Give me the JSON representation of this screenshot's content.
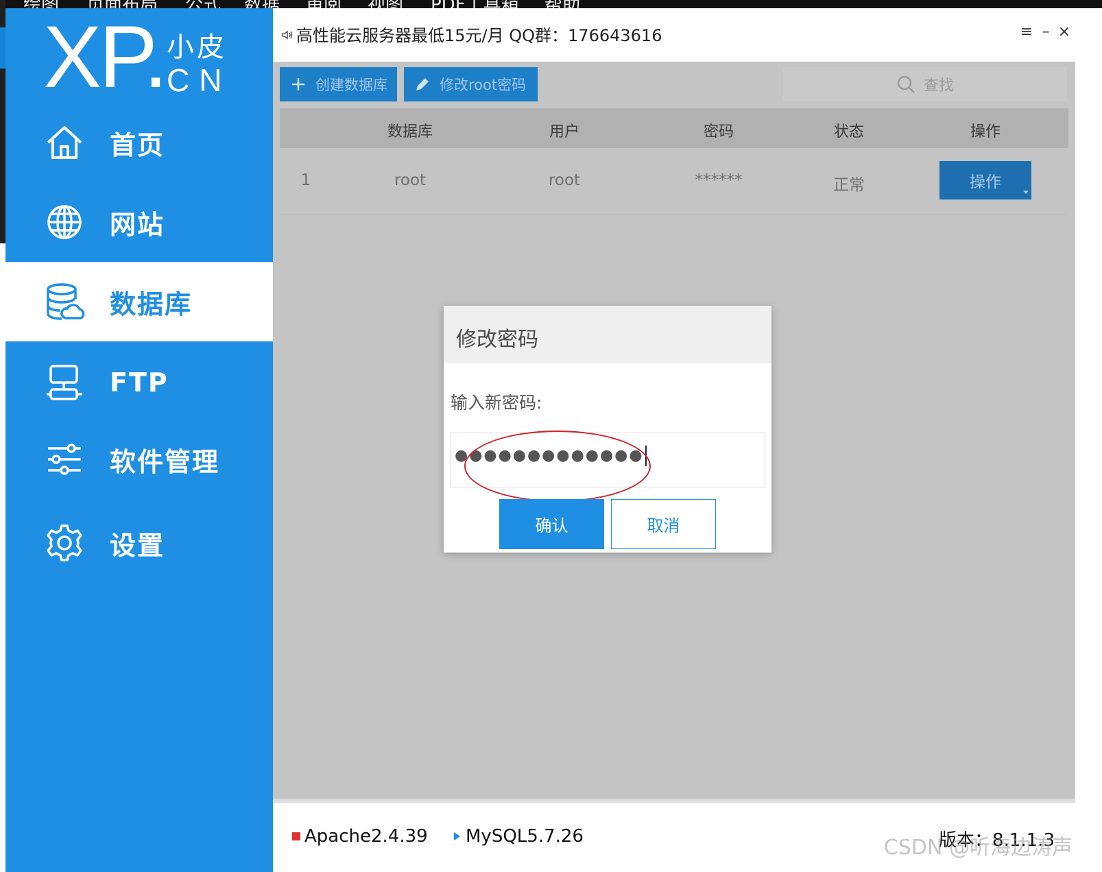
{
  "background": {
    "menu_items": [
      "绘图",
      "页面布局",
      "公式",
      "数据",
      "审阅",
      "视图",
      "PDF工具箱",
      "帮助"
    ]
  },
  "sidebar": {
    "logo": {
      "xp": "XP.",
      "cn_top": "小皮",
      "cn_bottom": "CN"
    },
    "items": [
      {
        "label": "首页",
        "icon": "home-icon"
      },
      {
        "label": "网站",
        "icon": "globe-icon"
      },
      {
        "label": "数据库",
        "icon": "database-icon"
      },
      {
        "label": "FTP",
        "icon": "ftp-server-icon"
      },
      {
        "label": "软件管理",
        "icon": "sliders-icon"
      },
      {
        "label": "设置",
        "icon": "gear-icon"
      }
    ],
    "active": "数据库"
  },
  "titlebar": {
    "ad_text": "高性能云服务器最低15元/月  QQ群：176643616",
    "controls": [
      "≡",
      "–",
      "×"
    ]
  },
  "toolbar": {
    "create_db_label": "创建数据库",
    "change_root_label": "修改root密码",
    "search_placeholder": "查找"
  },
  "table": {
    "columns": [
      "数据库",
      "用户",
      "密码",
      "状态",
      "操作"
    ],
    "rows": [
      {
        "index": "1",
        "database": "root",
        "user": "root",
        "password": "******",
        "status": "正常",
        "action": "操作"
      }
    ]
  },
  "modal": {
    "title": "修改密码",
    "label": "输入新密码:",
    "password_value": "●●●●●●●●●●●●●",
    "confirm_label": "确认",
    "cancel_label": "取消",
    "highlight_color": "#d4222a"
  },
  "statusbar": {
    "apache": "Apache2.4.39",
    "mysql": "MySQL5.7.26",
    "version": "版本：8.1.1.3",
    "watermark": "CSDN @听海边涛声"
  },
  "colors": {
    "accent": "#1e8fe3",
    "apache_indicator": "#e23131",
    "mysql_indicator": "#1e8fe3"
  }
}
